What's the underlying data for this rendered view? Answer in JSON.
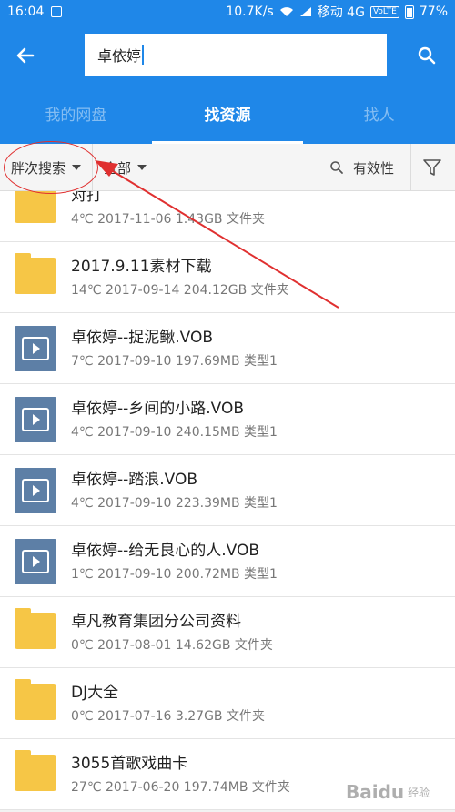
{
  "status_bar": {
    "time": "16:04",
    "speed": "10.7K/s",
    "carrier": "移动 4G",
    "volte": "VoLTE",
    "battery": "77%"
  },
  "search": {
    "query": "卓依婷"
  },
  "tabs": [
    {
      "label": "我的网盘",
      "active": false
    },
    {
      "label": "找资源",
      "active": true
    },
    {
      "label": "找人",
      "active": false
    }
  ],
  "filters": {
    "sort_label": "胖次搜索",
    "type_label": "全部",
    "validity_label": "有效性"
  },
  "files": [
    {
      "name": "对打",
      "meta": "4℃ 2017-11-06 1.43GB 文件夹",
      "icon": "folder-icon"
    },
    {
      "name": "2017.9.11素材下载",
      "meta": "14℃ 2017-09-14 204.12GB 文件夹",
      "icon": "folder-icon"
    },
    {
      "name": "卓依婷--捉泥鳅.VOB",
      "meta": "7℃ 2017-09-10 197.69MB 类型1",
      "icon": "video-file-icon"
    },
    {
      "name": "卓依婷--乡间的小路.VOB",
      "meta": "4℃ 2017-09-10 240.15MB 类型1",
      "icon": "video-file-icon"
    },
    {
      "name": "卓依婷--踏浪.VOB",
      "meta": "4℃ 2017-09-10 223.39MB 类型1",
      "icon": "video-file-icon"
    },
    {
      "name": "卓依婷--给无良心的人.VOB",
      "meta": "1℃ 2017-09-10 200.72MB 类型1",
      "icon": "video-file-icon"
    },
    {
      "name": "卓凡教育集团分公司资料",
      "meta": "0℃ 2017-08-01 14.62GB 文件夹",
      "icon": "folder-icon"
    },
    {
      "name": "DJ大全",
      "meta": "0℃ 2017-07-16 3.27GB 文件夹",
      "icon": "folder-icon"
    },
    {
      "name": "3055首歌戏曲卡",
      "meta": "27℃ 2017-06-20 197.74MB 文件夹",
      "icon": "folder-icon"
    }
  ],
  "watermark": {
    "brand": "Baidu",
    "sub": "经验"
  },
  "colors": {
    "primary": "#1f87e8",
    "folder": "#f6c646",
    "video_icon": "#5d7fa6",
    "annotation": "#e03030"
  }
}
